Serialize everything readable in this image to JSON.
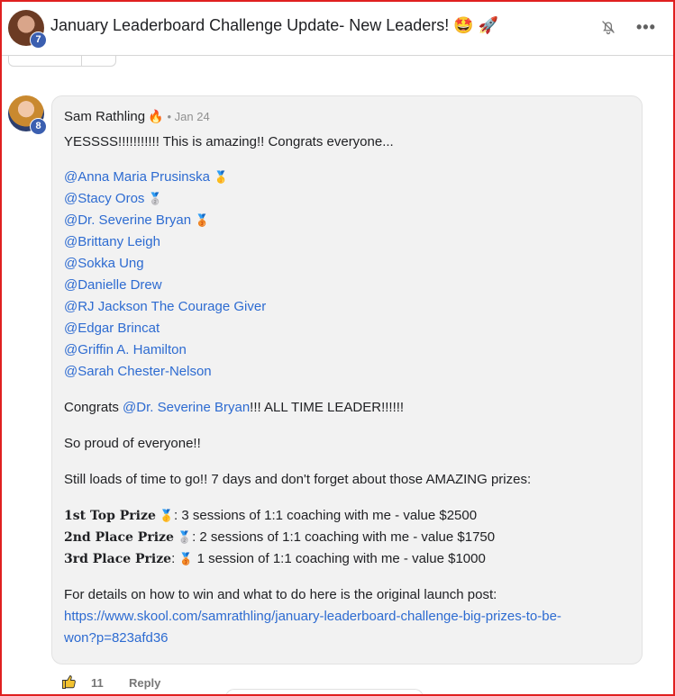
{
  "header": {
    "title": "January Leaderboard Challenge Update- New Leaders! 🤩 🚀",
    "level": "7",
    "more": "•••"
  },
  "post": {
    "author": "Sam Rathling",
    "author_emoji": "🔥",
    "date": "• Jan 24",
    "level": "8",
    "intro": "YESSSS!!!!!!!!!!! This is amazing!! Congrats everyone...",
    "mentions": [
      {
        "name": "@Anna Maria Prusinska",
        "medal": "🥇"
      },
      {
        "name": "@Stacy Oros",
        "medal": "🥈"
      },
      {
        "name": "@Dr. Severine Bryan",
        "medal": "🥉"
      },
      {
        "name": "@Brittany Leigh",
        "medal": ""
      },
      {
        "name": "@Sokka Ung",
        "medal": ""
      },
      {
        "name": "@Danielle Drew",
        "medal": ""
      },
      {
        "name": "@RJ Jackson The Courage Giver",
        "medal": ""
      },
      {
        "name": "@Edgar Brincat",
        "medal": ""
      },
      {
        "name": "@Griffin A. Hamilton",
        "medal": ""
      },
      {
        "name": "@Sarah Chester-Nelson",
        "medal": ""
      }
    ],
    "congrats_prefix": "Congrats ",
    "congrats_mention": "@Dr. Severine Bryan",
    "congrats_suffix": "!!! ALL TIME LEADER!!!!!!",
    "proud": "So proud of everyone!!",
    "still": "Still loads of time to go!! 7 days and don't forget about those AMAZING prizes:",
    "prizes": [
      {
        "label": "1st Top Prize",
        "medal": "🥇",
        "text": ": 3 sessions of 1:1 coaching with me - value $2500"
      },
      {
        "label": "2nd Place Prize",
        "medal": "🥈",
        "text": ": 2 sessions of 1:1 coaching with me - value $1750"
      },
      {
        "label": "3rd Place Prize",
        "medal": "🥉",
        "text": "1 session of 1:1 coaching with me - value $1000"
      }
    ],
    "prize3_colon": ":",
    "details": "For details on how to win and what to do here is the original launch post:",
    "link_line1": "https://www.skool.com/samrathling/january-leaderboard-challenge-big-prizes-to-be-",
    "link_line2": "won?p=823afd36"
  },
  "footer": {
    "likes": "11",
    "reply": "Reply"
  },
  "colors": {
    "mention": "#2d6bd1",
    "level_badge": "#3b5fb0",
    "frame": "#e02020"
  },
  "icons": [
    "bell-off-icon",
    "more-icon",
    "thumbs-up-icon"
  ]
}
